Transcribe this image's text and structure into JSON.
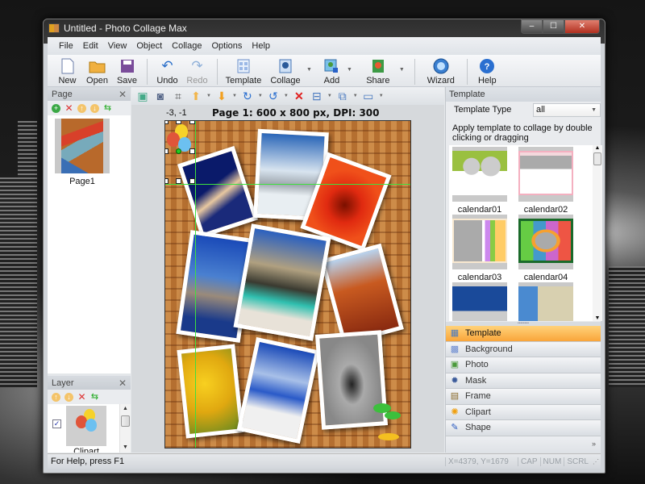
{
  "window": {
    "title": "Untitled - Photo Collage Max",
    "minimize": "–",
    "maximize": "☐",
    "close": "✕"
  },
  "menu": [
    "File",
    "Edit",
    "View",
    "Object",
    "Collage",
    "Options",
    "Help"
  ],
  "toolbar": {
    "new": "New",
    "open": "Open",
    "save": "Save",
    "undo": "Undo",
    "redo": "Redo",
    "template": "Template",
    "collage": "Collage",
    "add": "Add",
    "share": "Share",
    "wizard": "Wizard",
    "help": "Help"
  },
  "page_panel": {
    "title": "Page",
    "close": "✕",
    "pages": [
      {
        "label": "Page1"
      }
    ]
  },
  "layer_panel": {
    "title": "Layer",
    "close": "✕",
    "layers": [
      {
        "label": "Clipart",
        "checked": true
      }
    ]
  },
  "canvas": {
    "cursor_coords": "-3, -1",
    "page_info": "Page 1: 600 x 800 px, DPI: 300"
  },
  "template_panel": {
    "title": "Template",
    "type_label": "Template Type",
    "type_value": "all",
    "hint": "Apply template to collage by double clicking or dragging",
    "templates": [
      {
        "label": "calendar01"
      },
      {
        "label": "calendar02"
      },
      {
        "label": "calendar03"
      },
      {
        "label": "calendar04"
      },
      {
        "label": ""
      },
      {
        "label": ""
      }
    ]
  },
  "nav": [
    {
      "label": "Template",
      "icon": "template-icon",
      "active": true
    },
    {
      "label": "Background",
      "icon": "background-icon"
    },
    {
      "label": "Photo",
      "icon": "photo-icon"
    },
    {
      "label": "Mask",
      "icon": "mask-icon"
    },
    {
      "label": "Frame",
      "icon": "frame-icon"
    },
    {
      "label": "Clipart",
      "icon": "clipart-icon"
    },
    {
      "label": "Shape",
      "icon": "shape-icon"
    }
  ],
  "nav_more": "»",
  "status": {
    "help": "For Help, press F1",
    "coords": "X=4379, Y=1679",
    "cap": "CAP",
    "num": "NUM",
    "scrl": "SCRL"
  },
  "colors": {
    "accent": "#f9a53a",
    "guide": "#3ee03e",
    "canvas_bg": "#c27a36"
  }
}
